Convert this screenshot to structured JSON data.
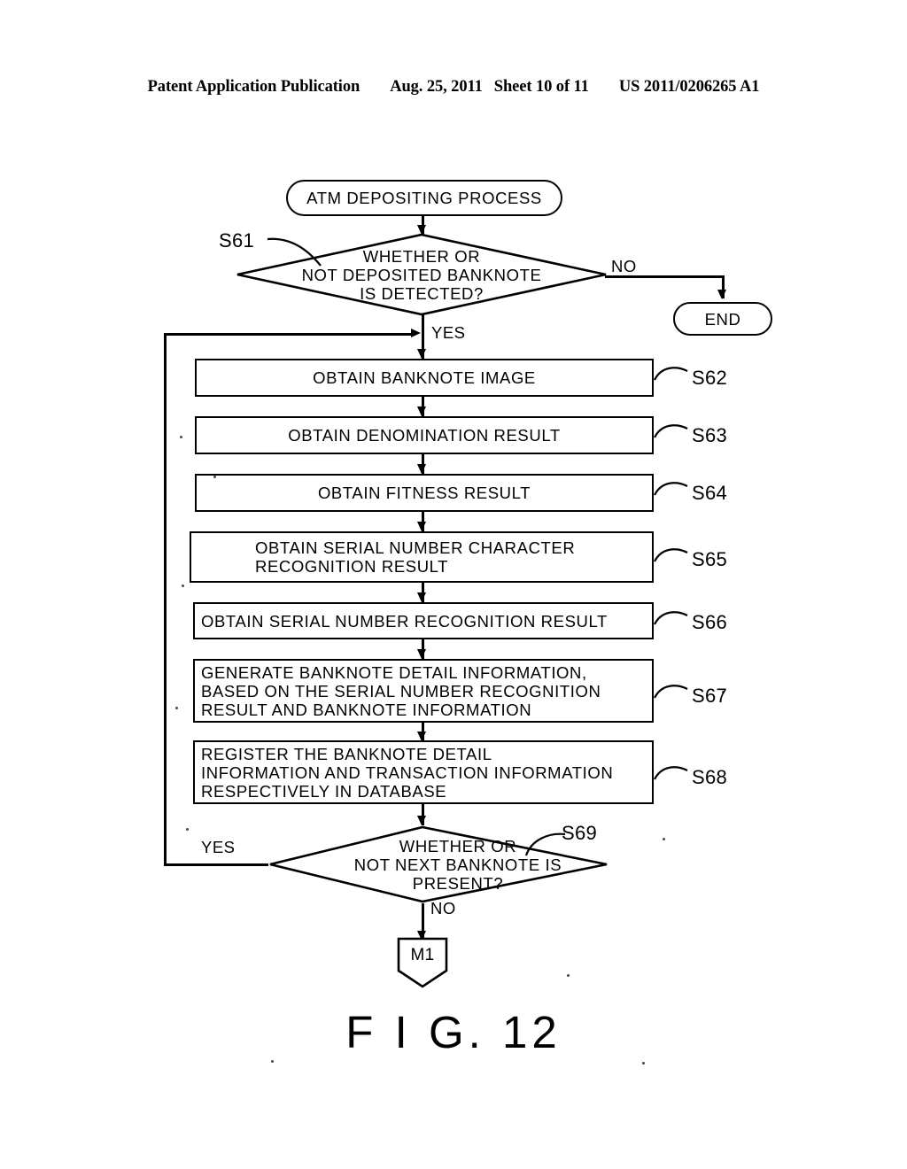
{
  "header": {
    "publication": "Patent Application Publication",
    "date": "Aug. 25, 2011",
    "sheet": "Sheet 10 of 11",
    "docnum": "US 2011/0206265 A1"
  },
  "figure": {
    "caption": "F I G. 12"
  },
  "flowchart": {
    "type": "flowchart",
    "title": "ATM DEPOSITING PROCESS",
    "start": {
      "id": "start",
      "shape": "terminator",
      "label": "ATM  DEPOSITING  PROCESS"
    },
    "end": {
      "id": "end",
      "shape": "terminator",
      "label": "END"
    },
    "connector": {
      "id": "M1",
      "shape": "off-page-connector",
      "label": "M1"
    },
    "decisions": [
      {
        "step": "S61",
        "shape": "decision",
        "label": "WHETHER  OR\nNOT  DEPOSITED  BANKNOTE\nIS  DETECTED?",
        "yes_label": "YES",
        "no_label": "NO"
      },
      {
        "step": "S69",
        "shape": "decision",
        "label": "WHETHER  OR\nNOT  NEXT  BANKNOTE  IS\nPRESENT?",
        "yes_label": "YES",
        "no_label": "NO"
      }
    ],
    "steps": [
      {
        "step": "S62",
        "shape": "process",
        "align": "center",
        "label": "OBTAIN  BANKNOTE  IMAGE"
      },
      {
        "step": "S63",
        "shape": "process",
        "align": "center",
        "label": "OBTAIN  DENOMINATION  RESULT"
      },
      {
        "step": "S64",
        "shape": "process",
        "align": "center",
        "label": "OBTAIN  FITNESS  RESULT"
      },
      {
        "step": "S65",
        "shape": "process",
        "align": "left",
        "label": "OBTAIN  SERIAL  NUMBER  CHARACTER\nRECOGNITION  RESULT"
      },
      {
        "step": "S66",
        "shape": "process",
        "align": "left",
        "label": "OBTAIN  SERIAL  NUMBER  RECOGNITION  RESULT"
      },
      {
        "step": "S67",
        "shape": "process",
        "align": "left",
        "label": "GENERATE  BANKNOTE  DETAIL  INFORMATION,\nBASED  ON  THE  SERIAL  NUMBER  RECOGNITION\nRESULT  AND  BANKNOTE  INFORMATION"
      },
      {
        "step": "S68",
        "shape": "process",
        "align": "left",
        "label": "REGISTER  THE  BANKNOTE  DETAIL\nINFORMATION  AND  TRANSACTION  INFORMATION\nRESPECTIVELY  IN  DATABASE"
      }
    ],
    "step_labels": {
      "s61": "S61",
      "s62": "S62",
      "s63": "S63",
      "s64": "S64",
      "s65": "S65",
      "s66": "S66",
      "s67": "S67",
      "s68": "S68",
      "s69": "S69"
    },
    "edge_labels": {
      "s61_no": "NO",
      "s61_yes": "YES",
      "s69_no": "NO",
      "s69_yes": "YES"
    },
    "colors": {
      "ink": "#000000",
      "paper": "#ffffff"
    }
  }
}
